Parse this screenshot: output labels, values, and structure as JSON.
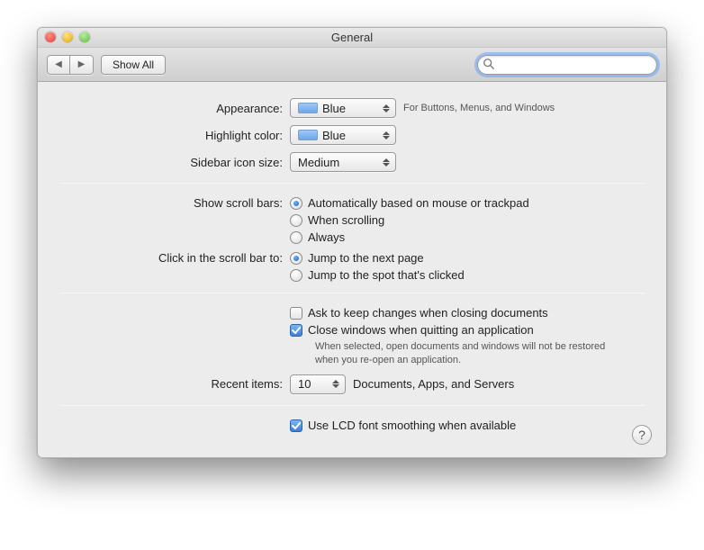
{
  "window": {
    "title": "General"
  },
  "toolbar": {
    "show_all": "Show All",
    "search_placeholder": ""
  },
  "labels": {
    "appearance": "Appearance:",
    "highlight": "Highlight color:",
    "sidebar": "Sidebar icon size:",
    "scrollbars": "Show scroll bars:",
    "clickscroll": "Click in the scroll bar to:",
    "recent": "Recent items:"
  },
  "appearance": {
    "value": "Blue",
    "hint": "For Buttons, Menus, and Windows",
    "color": "#6ea6e8"
  },
  "highlight": {
    "value": "Blue",
    "color": "#6ea6e8"
  },
  "sidebar_size": {
    "value": "Medium"
  },
  "scroll": {
    "options": [
      "Automatically based on mouse or trackpad",
      "When scrolling",
      "Always"
    ],
    "selected": 0
  },
  "click_scroll": {
    "options": [
      "Jump to the next page",
      "Jump to the spot that's clicked"
    ],
    "selected": 0
  },
  "checks": {
    "ask_keep": {
      "label": "Ask to keep changes when closing documents",
      "checked": false
    },
    "close_windows": {
      "label": "Close windows when quitting an application",
      "checked": true,
      "hint": "When selected, open documents and windows will not be restored when you re-open an application."
    },
    "lcd": {
      "label": "Use LCD font smoothing when available",
      "checked": true
    }
  },
  "recent": {
    "value": "10",
    "suffix": "Documents, Apps, and Servers"
  },
  "help": "?"
}
